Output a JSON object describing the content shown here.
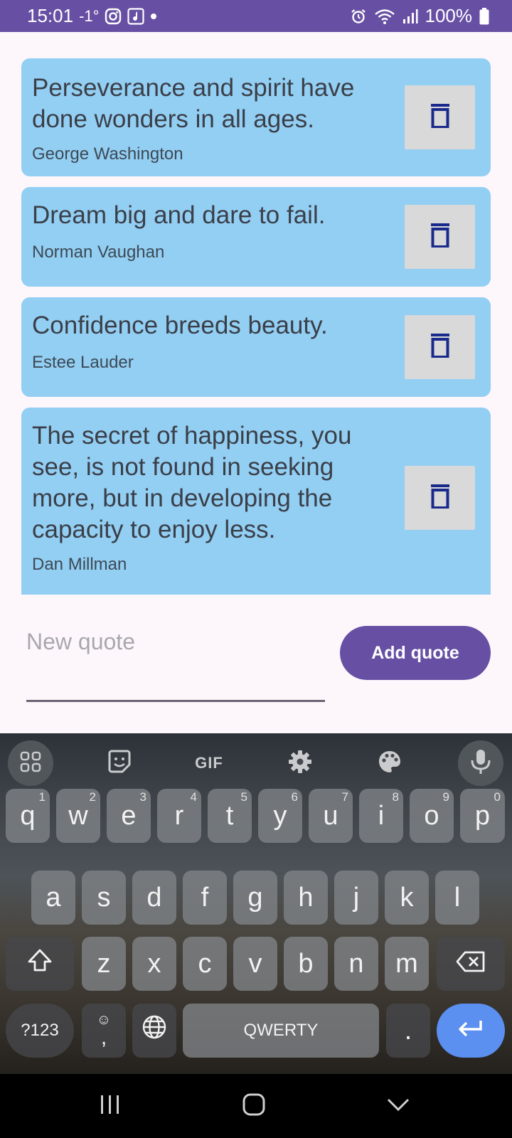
{
  "status_bar": {
    "time": "15:01",
    "temperature": "-1°",
    "battery": "100%",
    "icons": [
      "instagram-icon",
      "music-app-icon",
      "dot-icon",
      "alarm-icon",
      "wifi-icon",
      "signal-icon",
      "battery-icon"
    ]
  },
  "quotes": [
    {
      "text": "Perseverance and spirit have done wonders in all ages.",
      "author": "George Washington"
    },
    {
      "text": "Dream big and dare to fail.",
      "author": "Norman Vaughan"
    },
    {
      "text": "Confidence breeds beauty.",
      "author": "Estee Lauder"
    },
    {
      "text": "The secret of happiness, you see, is not found in seeking more, but in developing the capacity to enjoy less.",
      "author": "Dan Millman"
    }
  ],
  "input": {
    "placeholder": "New quote",
    "value": ""
  },
  "add_button_label": "Add quote",
  "keyboard": {
    "toolbar": {
      "gif_label": "GIF",
      "icons": [
        "apps-grid-icon",
        "sticker-icon",
        "gif-icon",
        "settings-icon",
        "palette-icon",
        "microphone-icon"
      ]
    },
    "row1": [
      {
        "k": "q",
        "h": "1"
      },
      {
        "k": "w",
        "h": "2"
      },
      {
        "k": "e",
        "h": "3"
      },
      {
        "k": "r",
        "h": "4"
      },
      {
        "k": "t",
        "h": "5"
      },
      {
        "k": "y",
        "h": "6"
      },
      {
        "k": "u",
        "h": "7"
      },
      {
        "k": "i",
        "h": "8"
      },
      {
        "k": "o",
        "h": "9"
      },
      {
        "k": "p",
        "h": "0"
      }
    ],
    "row2": [
      "a",
      "s",
      "d",
      "f",
      "g",
      "h",
      "j",
      "k",
      "l"
    ],
    "row3": [
      "z",
      "x",
      "c",
      "v",
      "b",
      "n",
      "m"
    ],
    "symbols_label": "?123",
    "comma_label": ",",
    "emoji_hint": "☺",
    "space_label": "QWERTY",
    "period_label": "."
  },
  "colors": {
    "primary": "#6750a4",
    "card_bg": "#93cef3",
    "delete_icon": "#1a2a8c",
    "enter_key": "#5b8ff0"
  }
}
